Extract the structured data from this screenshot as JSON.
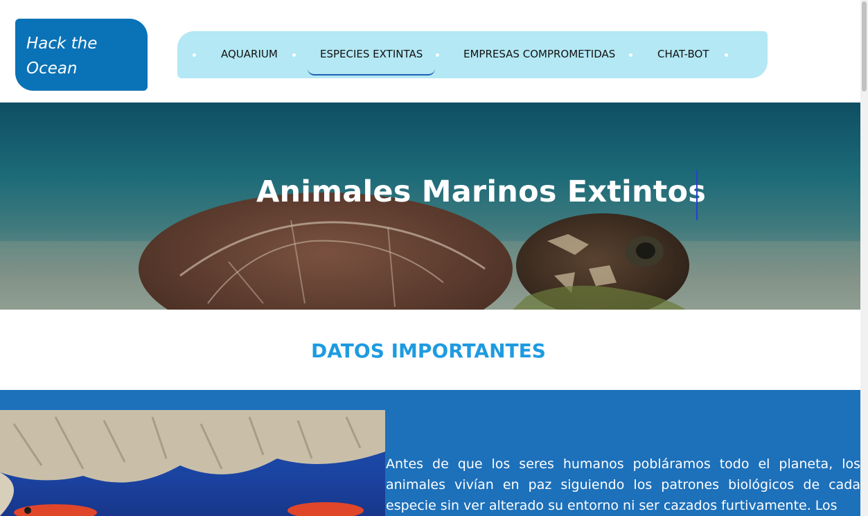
{
  "logo": {
    "line1": "Hack the",
    "line2": "Ocean"
  },
  "nav": {
    "items": [
      {
        "label": "AQUARIUM"
      },
      {
        "label": "ESPECIES EXTINTAS",
        "active": true
      },
      {
        "label": "EMPRESAS COMPROMETIDAS"
      },
      {
        "label": "CHAT-BOT"
      }
    ]
  },
  "hero": {
    "title": "Animales Marinos Extintos"
  },
  "section": {
    "title": "DATOS IMPORTANTES"
  },
  "content": {
    "paragraph": "Antes de que los seres humanos pobláramos todo el planeta, los animales vivían en paz siguiendo los patrones biológicos de cada especie sin ver alterado su entorno ni ser cazados furtivamente. Los"
  },
  "colors": {
    "logo_bg": "#0a72b6",
    "nav_bg": "#b3e8f4",
    "active_underline": "#1f5fb2",
    "section_title": "#1e9be0",
    "content_band": "#1d70ba"
  }
}
